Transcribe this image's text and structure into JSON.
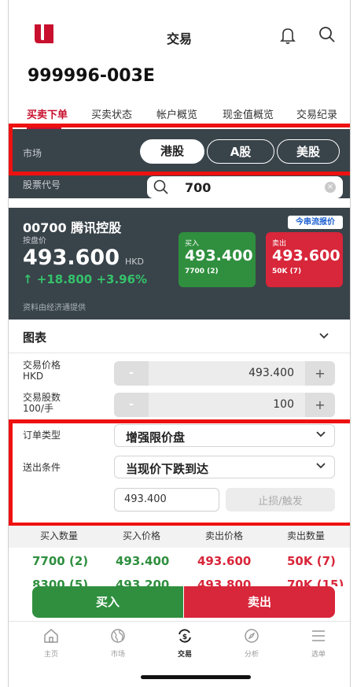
{
  "header": {
    "title": "交易"
  },
  "account": "999996-003E",
  "tabs": [
    "买卖下单",
    "买卖状态",
    "帐户概览",
    "现金值概览",
    "交易纪录"
  ],
  "market": {
    "label": "市场",
    "options": [
      "港股",
      "A股",
      "美股"
    ],
    "selected": "港股"
  },
  "stock_code": {
    "label": "股票代号",
    "value": "700"
  },
  "quote": {
    "name": "00700 腾讯控股",
    "sub_label": "按盘价",
    "price": "493.600",
    "currency": "HKD",
    "change": "↑  +18.800 +3.96%",
    "source": "资料由经济通提供",
    "badge": "今串流报价",
    "buy": {
      "label": "买入",
      "price": "493.400",
      "size": "7700 (2)"
    },
    "sell": {
      "label": "卖出",
      "price": "493.600",
      "size": "50K (7)"
    }
  },
  "chart_section": {
    "label": "图表"
  },
  "form": {
    "price_label": "交易价格",
    "price_unit": "HKD",
    "price_value": "493.400",
    "qty_label": "交易股数",
    "qty_unit": "100/手",
    "qty_value": "100",
    "minus": "-",
    "plus": "+",
    "order_type_label": "订单类型",
    "order_type_value": "增强限价盘",
    "condition_label": "送出条件",
    "condition_value": "当现价下跌到达",
    "trigger_price_value": "493.400",
    "trigger_placeholder": "止损/触发"
  },
  "orderbook": {
    "headers": [
      "买入数量",
      "买入价格",
      "卖出价格",
      "卖出数量"
    ],
    "rows": [
      [
        "7700 (2)",
        "493.400",
        "493.600",
        "50K (7)"
      ],
      [
        "8300 (5)",
        "493.200",
        "493.800",
        "70K (15)"
      ]
    ]
  },
  "actions": {
    "buy": "买入",
    "sell": "卖出"
  },
  "nav": [
    {
      "label": "主页",
      "icon": "home-icon"
    },
    {
      "label": "市场",
      "icon": "globe-icon"
    },
    {
      "label": "交易",
      "icon": "trade-icon"
    },
    {
      "label": "分析",
      "icon": "compass-icon"
    },
    {
      "label": "选单",
      "icon": "menu-icon"
    }
  ],
  "colors": {
    "accent_red": "#c8102e",
    "buy_green": "#2f8f3e",
    "sell_red": "#d8263a",
    "panel_dark": "#39434a",
    "highlight": "#ee1111"
  }
}
